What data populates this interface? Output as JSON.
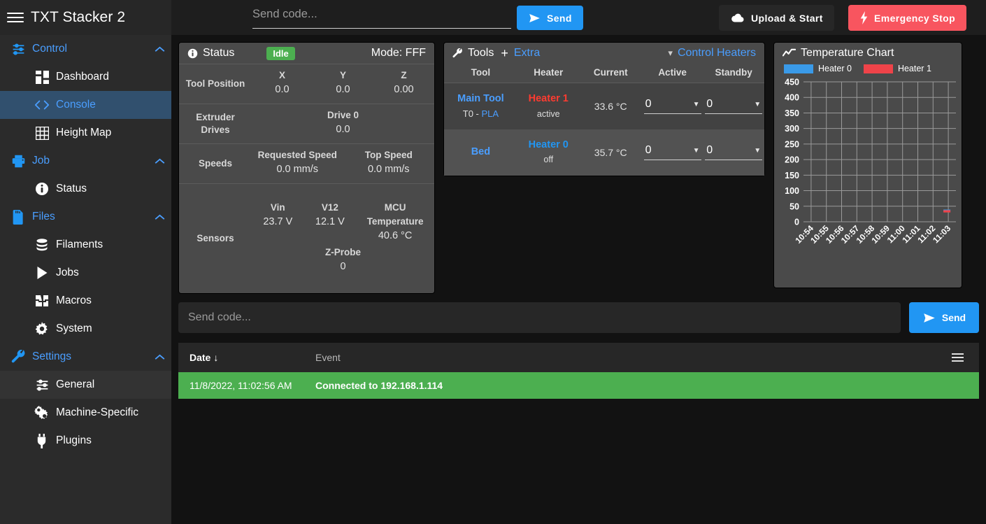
{
  "topbar": {
    "menu_icon": "hamburger-icon",
    "app_title": "TXT Stacker 2",
    "code_placeholder": "Send code...",
    "send_label": "Send",
    "send_icon": "paper-plane-icon",
    "upload_label": "Upload & Start",
    "upload_icon": "cloud-upload-icon",
    "estop_label": "Emergency Stop",
    "estop_icon": "lightning-bolt-icon",
    "accent": "#2196f3",
    "danger": "#f8555f"
  },
  "sidebar": {
    "groups": [
      {
        "label": "Control",
        "icon": "sliders-icon",
        "expanded": true,
        "items": [
          {
            "label": "Dashboard",
            "icon": "dashboard-icon",
            "active": false
          },
          {
            "label": "Console",
            "icon": "code-icon",
            "active": true
          },
          {
            "label": "Height Map",
            "icon": "grid-icon",
            "active": false
          }
        ]
      },
      {
        "label": "Job",
        "icon": "printer-icon",
        "expanded": true,
        "items": [
          {
            "label": "Status",
            "icon": "info-circle-icon",
            "active": false
          }
        ]
      },
      {
        "label": "Files",
        "icon": "sd-card-icon",
        "expanded": true,
        "items": [
          {
            "label": "Filaments",
            "icon": "database-icon",
            "active": false
          },
          {
            "label": "Jobs",
            "icon": "play-icon",
            "active": false
          },
          {
            "label": "Macros",
            "icon": "macros-icon",
            "active": false
          },
          {
            "label": "System",
            "icon": "gear-icon",
            "active": false
          }
        ]
      },
      {
        "label": "Settings",
        "icon": "wrench-icon",
        "expanded": true,
        "items": [
          {
            "label": "General",
            "icon": "sliders-icon",
            "active": false,
            "hover": true
          },
          {
            "label": "Machine-Specific",
            "icon": "cogs-icon",
            "active": false
          },
          {
            "label": "Plugins",
            "icon": "plug-icon",
            "active": false
          }
        ]
      }
    ]
  },
  "status_panel": {
    "icon": "info-circle-icon",
    "title": "Status",
    "state_badge": "Idle",
    "badge_color": "#4caf50",
    "mode": "Mode: FFF",
    "rows": [
      {
        "label": "Tool Position",
        "cells": [
          {
            "k": "X",
            "v": "0.0"
          },
          {
            "k": "Y",
            "v": "0.0"
          },
          {
            "k": "Z",
            "v": "0.00"
          }
        ]
      },
      {
        "label": "Extruder Drives",
        "cells": [
          {
            "k": "Drive 0",
            "v": "0.0"
          }
        ]
      },
      {
        "label": "Speeds",
        "cells": [
          {
            "k": "Requested Speed",
            "v": "0.0 mm/s"
          },
          {
            "k": "Top Speed",
            "v": "0.0 mm/s"
          }
        ]
      },
      {
        "label": "Sensors",
        "cells": [
          {
            "k": "Vin",
            "v": "23.7 V"
          },
          {
            "k": "V12",
            "v": "12.1 V"
          },
          {
            "k": "MCU Temperature",
            "v": "40.6 °C"
          }
        ],
        "extra": {
          "k": "Z-Probe",
          "v": "0"
        }
      }
    ]
  },
  "tools_panel": {
    "icon": "wrench-icon",
    "title": "Tools",
    "add_symbol": "+",
    "extra_label": "Extra",
    "control_heaters_label": "Control Heaters",
    "control_heaters_caret": "▾",
    "columns": [
      "Tool",
      "Heater",
      "Current",
      "Active",
      "Standby"
    ],
    "rows": [
      {
        "tool": "Main Tool",
        "tool_sub_prefix": "T0 - ",
        "tool_sub_filament": "PLA",
        "heater": "Heater 1",
        "heater_color": "#ff3b30",
        "heater_state": "active",
        "current": "33.6 °C",
        "active": "0",
        "standby": "0"
      },
      {
        "tool": "Bed",
        "tool_sub_prefix": "",
        "tool_sub_filament": "",
        "heater": "Heater 0",
        "heater_color": "#2196f3",
        "heater_state": "off",
        "current": "35.7 °C",
        "active": "0",
        "standby": "0"
      }
    ]
  },
  "chart_panel": {
    "icon": "chart-line-icon",
    "title": "Temperature Chart"
  },
  "chart_data": {
    "type": "line",
    "title": "Temperature Chart",
    "xlabel": "",
    "ylabel": "",
    "ylim": [
      0,
      450
    ],
    "yticks": [
      0,
      50,
      100,
      150,
      200,
      250,
      300,
      350,
      400,
      450
    ],
    "x": [
      "10:54",
      "10:55",
      "10:56",
      "10:57",
      "10:58",
      "10:59",
      "11:00",
      "11:01",
      "11:02",
      "11:03"
    ],
    "grid": true,
    "legend_position": "top",
    "series": [
      {
        "name": "Heater 0",
        "color": "#3a9ae8",
        "values": [
          null,
          null,
          null,
          null,
          null,
          null,
          null,
          null,
          null,
          35.7
        ]
      },
      {
        "name": "Heater 1",
        "color": "#ef4349",
        "values": [
          null,
          null,
          null,
          null,
          null,
          null,
          null,
          null,
          null,
          33.6
        ]
      }
    ]
  },
  "console": {
    "input_placeholder": "Send code...",
    "send_label": "Send",
    "send_icon": "paper-plane-icon",
    "columns": {
      "date": "Date",
      "date_sort_icon": "↓",
      "event": "Event"
    },
    "menu_icon": "hamburger-menu-icon",
    "rows": [
      {
        "date": "11/8/2022, 11:02:56 AM",
        "event": "Connected to 192.168.1.114",
        "color": "#4caf50"
      }
    ]
  }
}
